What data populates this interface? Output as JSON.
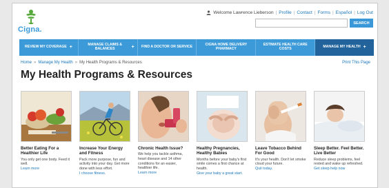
{
  "brand": {
    "logo_text": "Cigna.",
    "accent": "#3c9ad8",
    "active": "#21639a"
  },
  "utility": {
    "welcome": "Welcome Lawrence Lieberson",
    "links": [
      "Profile",
      "Contact",
      "Forms",
      "Español",
      "Log Out"
    ]
  },
  "search": {
    "placeholder": "",
    "button": "SEARCH"
  },
  "nav": {
    "items": [
      {
        "label": "REVIEW MY COVERAGE",
        "plus": "+"
      },
      {
        "label": "MANAGE CLAIMS & BALANCES",
        "plus": "+"
      },
      {
        "label": "FIND A DOCTOR OR SERVICE",
        "plus": ""
      },
      {
        "label": "CIGNA HOME DELIVERY PHARMACY",
        "plus": ""
      },
      {
        "label": "ESTIMATE HEALTH CARE COSTS",
        "plus": ""
      },
      {
        "label": "MANAGE MY HEALTH",
        "plus": "+"
      }
    ]
  },
  "breadcrumb": {
    "home": "Home",
    "parent": "Manage My Health",
    "current": "My Health Programs & Resources",
    "sep": "»"
  },
  "print_label": "Print This Page",
  "page_title": "My Health Programs & Resources",
  "cards": [
    {
      "title": "Better Eating For a Healthier Life",
      "desc": "You only get one body. Feed it well.",
      "link": "Learn more"
    },
    {
      "title": "Increase Your Energy and Fitness",
      "desc": "Pack more purpose, fun and activity into your day. Get more done with less effort.",
      "link": "I choose fitness."
    },
    {
      "title": "Chronic Health Issue?",
      "desc": "We help you tackle asthma, heart disease and 14 other conditions for an easier, healthier life.",
      "link": "Learn more"
    },
    {
      "title": "Healthy Pregnancies, Healthy Babies",
      "desc": "Months before your baby's first smile comes a first chance at health.",
      "link": "Give your baby a great start."
    },
    {
      "title": "Leave Tobacco Behind For Good",
      "desc": "It's your health. Don't let smoke cloud your future.",
      "link": "Quit today."
    },
    {
      "title": "Sleep Better. Feel Better. Live Better",
      "desc": "Reduce sleep problems, feel rested and wake up refreshed.",
      "link": "Get sleep help now"
    }
  ]
}
